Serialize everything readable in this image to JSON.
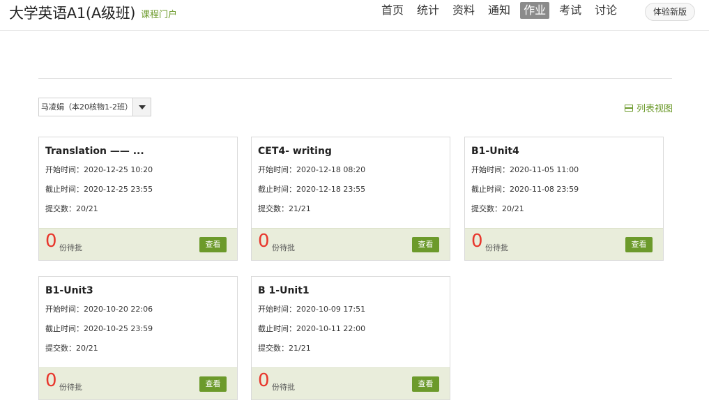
{
  "header": {
    "course_title": "大学英语A1(A级班)",
    "portal_link": "课程门户",
    "nav": [
      "首页",
      "统计",
      "资料",
      "通知",
      "作业",
      "考试",
      "讨论"
    ],
    "active_nav": "作业",
    "new_version_button": "体验新版"
  },
  "filter": {
    "class_select_value": "马凌娟（本20核物1-2班）",
    "list_view_label": "列表视图"
  },
  "labels": {
    "start_prefix": "开始时间：",
    "deadline_prefix": "截止时间：",
    "submitted_prefix": "提交数：",
    "pending_suffix": "份待批",
    "view_button": "查看"
  },
  "assignments": [
    {
      "title": "Translation —— ...",
      "start": "开始时间：2020-12-25 10:20",
      "deadline": "截止时间：2020-12-25 23:55",
      "submitted": "提交数：20/21",
      "pending": "0",
      "pending_label": "份待批",
      "view": "查看"
    },
    {
      "title": "CET4- writing",
      "start": "开始时间：2020-12-18 08:20",
      "deadline": "截止时间：2020-12-18 23:55",
      "submitted": "提交数：21/21",
      "pending": "0",
      "pending_label": "份待批",
      "view": "查看"
    },
    {
      "title": "B1-Unit4",
      "start": "开始时间：2020-11-05 11:00",
      "deadline": "截止时间：2020-11-08 23:59",
      "submitted": "提交数：20/21",
      "pending": "0",
      "pending_label": "份待批",
      "view": "查看"
    },
    {
      "title": "B1-Unit3",
      "start": "开始时间：2020-10-20 22:06",
      "deadline": "截止时间：2020-10-25 23:59",
      "submitted": "提交数：20/21",
      "pending": "0",
      "pending_label": "份待批",
      "view": "查看"
    },
    {
      "title": "B 1-Unit1",
      "start": "开始时间：2020-10-09 17:51",
      "deadline": "截止时间：2020-10-11 22:00",
      "submitted": "提交数：21/21",
      "pending": "0",
      "pending_label": "份待批",
      "view": "查看"
    }
  ],
  "colors": {
    "accent_green": "#6c9a2b",
    "pending_red": "#e8362c",
    "card_footer_bg": "#e9eddb",
    "active_nav_bg": "#8b8b8b"
  }
}
